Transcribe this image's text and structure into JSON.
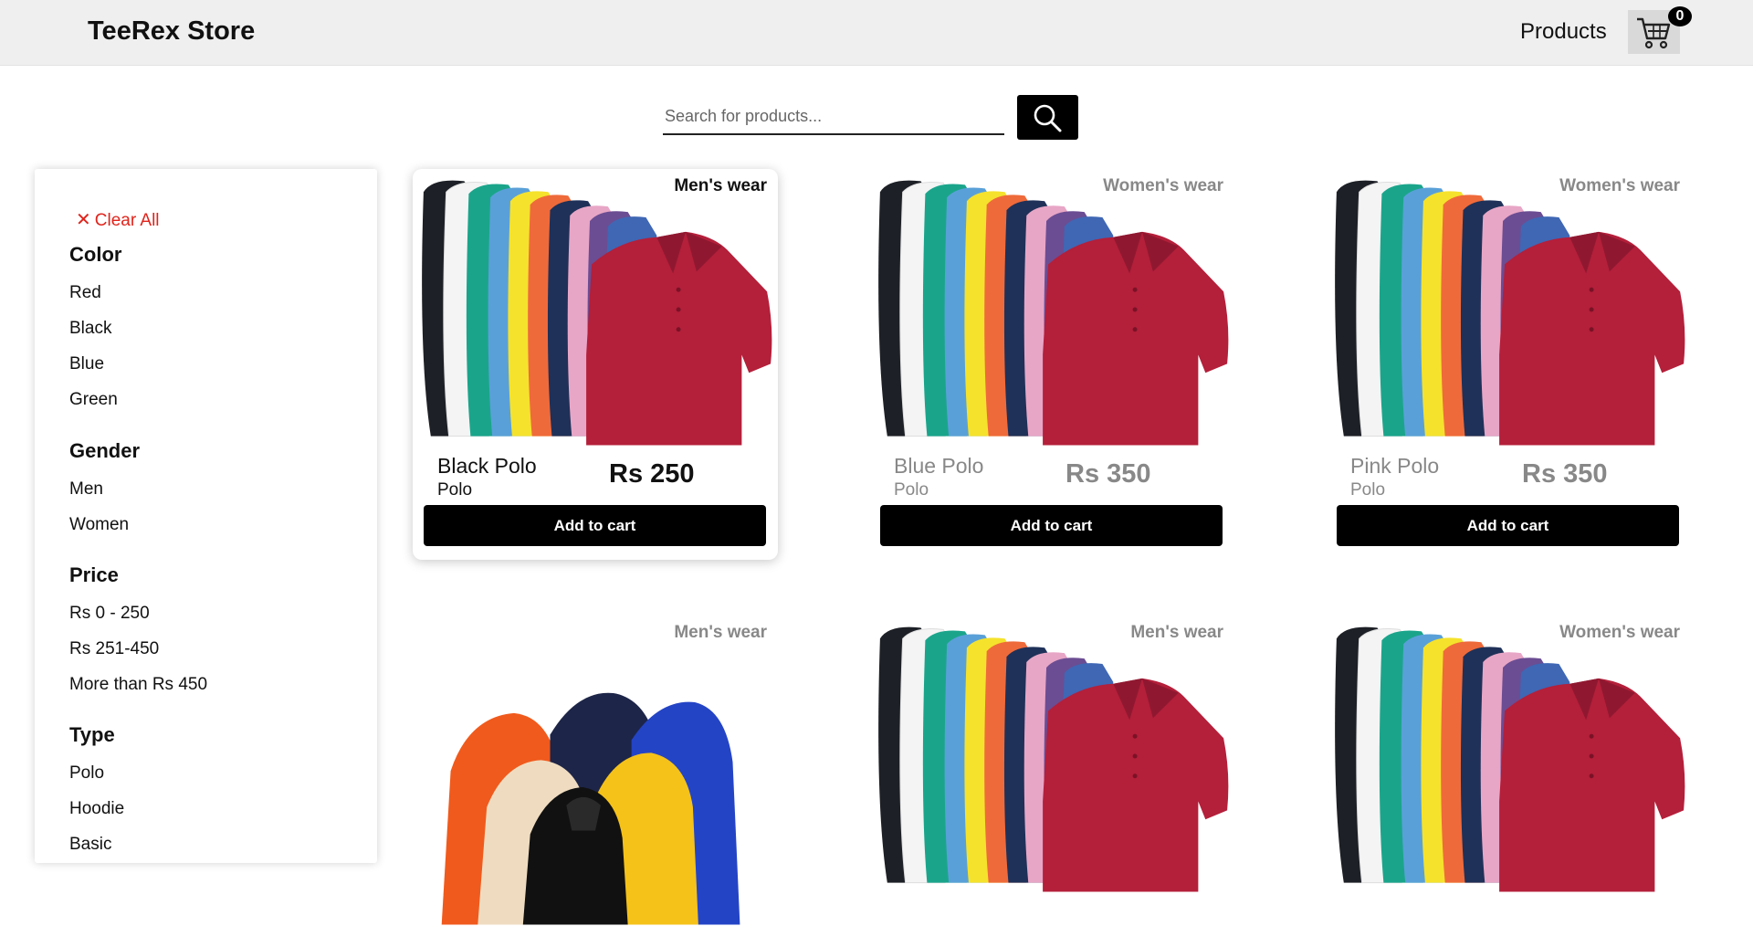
{
  "header": {
    "brand": "TeeRex Store",
    "nav_products": "Products",
    "cart_count": "0"
  },
  "search": {
    "placeholder": "Search for products...",
    "value": ""
  },
  "filters": {
    "clear_all": "Clear All",
    "groups": [
      {
        "title": "Color",
        "options": [
          "Red",
          "Black",
          "Blue",
          "Green"
        ]
      },
      {
        "title": "Gender",
        "options": [
          "Men",
          "Women"
        ]
      },
      {
        "title": "Price",
        "options": [
          "Rs 0 - 250",
          "Rs 251-450",
          "More than Rs 450"
        ]
      },
      {
        "title": "Type",
        "options": [
          "Polo",
          "Hoodie",
          "Basic"
        ]
      }
    ]
  },
  "products": [
    {
      "tag": "Men's wear",
      "name": "Black Polo",
      "type": "Polo",
      "price": "Rs 250",
      "button": "Add to cart",
      "image": "polo-shirts"
    },
    {
      "tag": "Women's wear",
      "name": "Blue Polo",
      "type": "Polo",
      "price": "Rs 350",
      "button": "Add to cart",
      "image": "polo-shirts"
    },
    {
      "tag": "Women's wear",
      "name": "Pink Polo",
      "type": "Polo",
      "price": "Rs 350",
      "button": "Add to cart",
      "image": "polo-shirts"
    },
    {
      "tag": "Men's wear",
      "image": "hoodies"
    },
    {
      "tag": "Men's wear",
      "image": "polo-shirts"
    },
    {
      "tag": "Women's wear",
      "image": "polo-shirts"
    }
  ],
  "colors": {
    "accent_clear": "#e0241c",
    "header_bg": "#efefef",
    "button_bg": "#000000"
  }
}
